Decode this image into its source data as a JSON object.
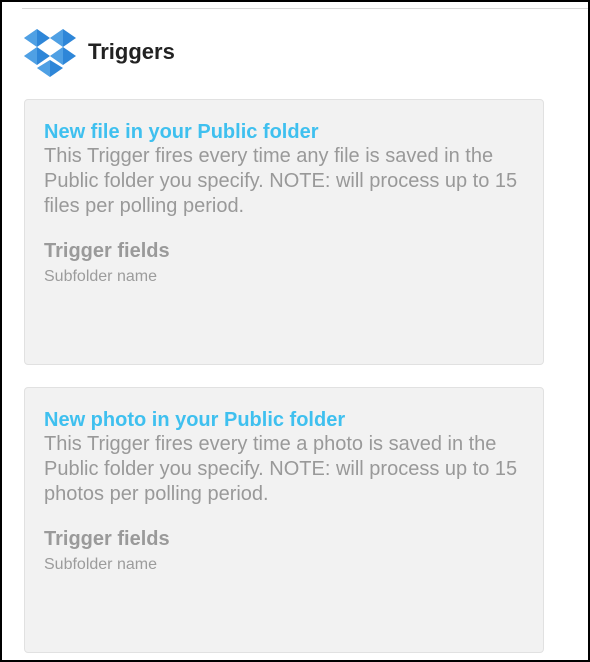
{
  "header": {
    "icon": "dropbox-icon",
    "title": "Triggers",
    "brand_color": "#2e86d8"
  },
  "triggers": [
    {
      "title": "New file in your Public folder",
      "description": "This Trigger fires every time any file is saved in the Public folder you specify. NOTE: will process up to 15 files per polling period.",
      "fields_heading": "Trigger fields",
      "fields": [
        "Subfolder name"
      ]
    },
    {
      "title": "New photo in your Public folder",
      "description": "This Trigger fires every time a photo is saved in the Public folder you specify. NOTE: will process up to 15 photos per polling period.",
      "fields_heading": "Trigger fields",
      "fields": [
        "Subfolder name"
      ]
    }
  ],
  "colors": {
    "trigger_title": "#3fc0ef",
    "card_background": "#f2f2f2",
    "muted_text": "#999999"
  }
}
